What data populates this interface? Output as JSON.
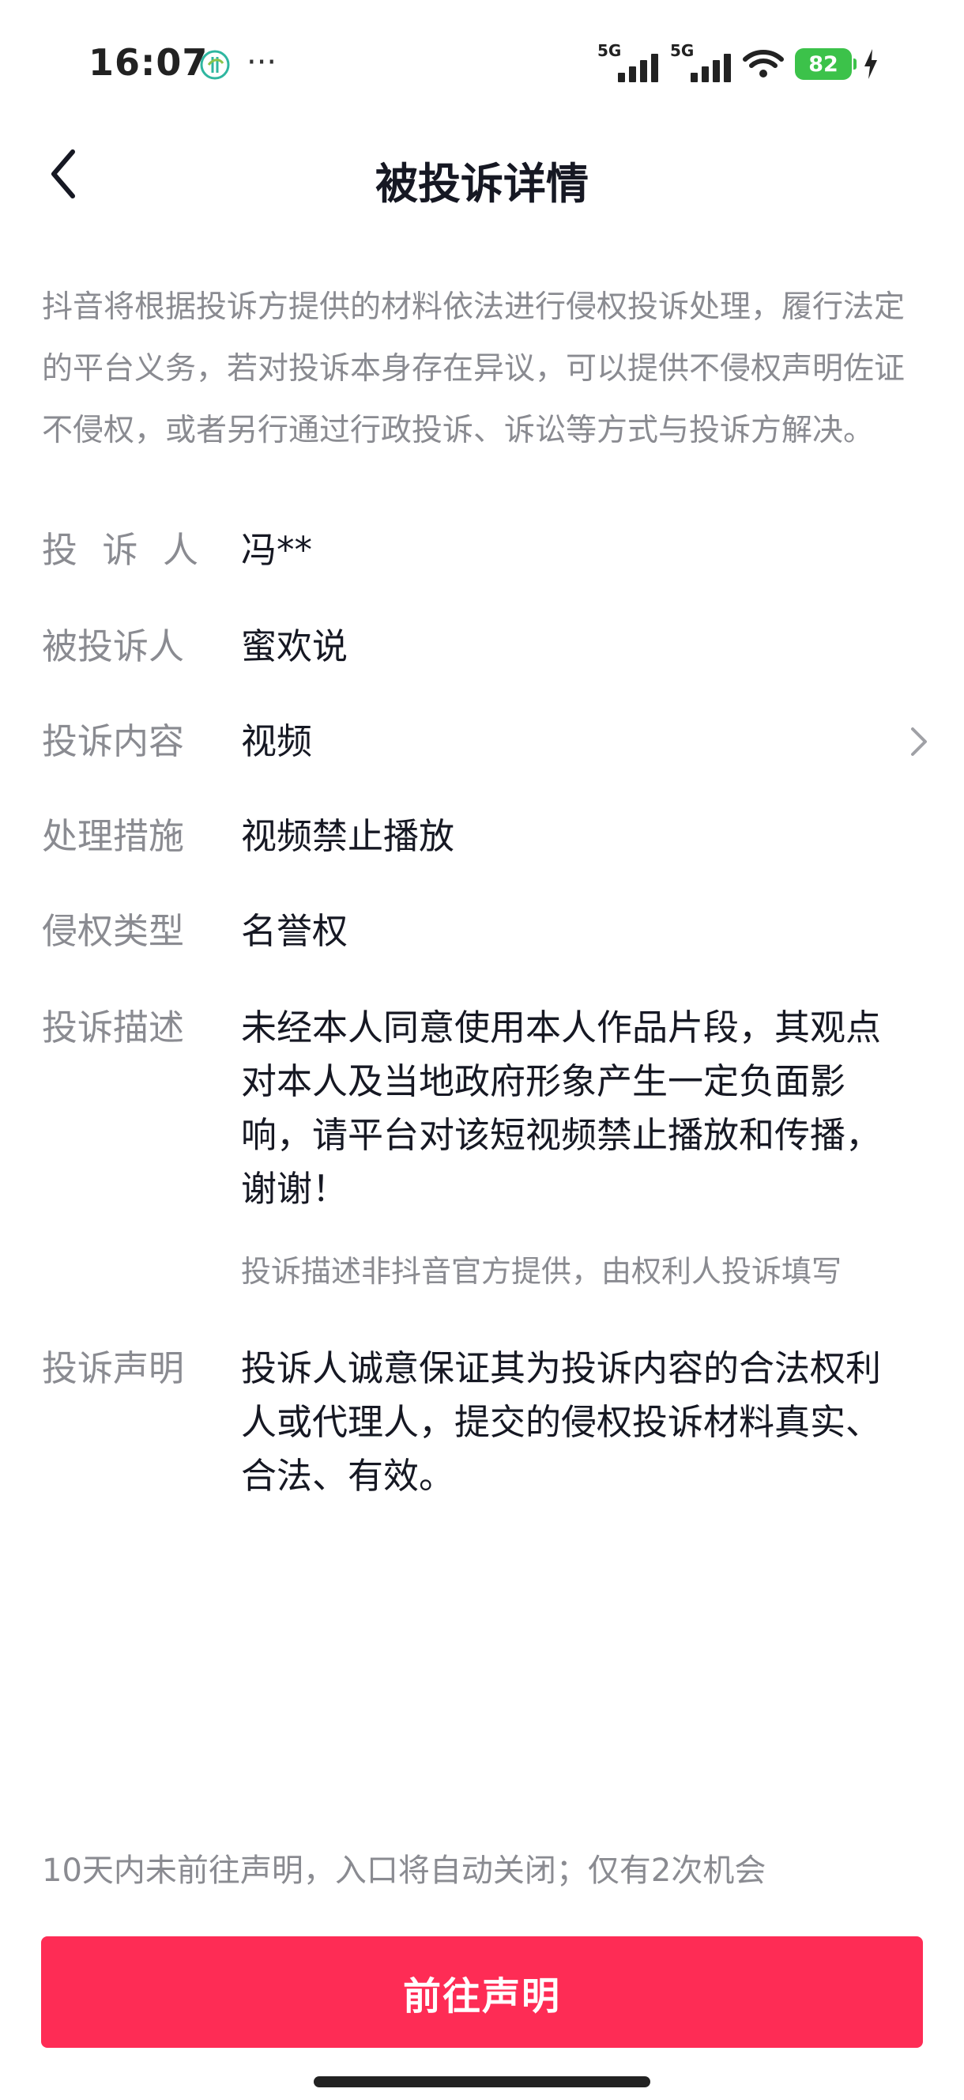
{
  "status_bar": {
    "time": "16:07",
    "more": "···",
    "network_1": "5G",
    "network_2": "5G",
    "battery": "82",
    "icons": [
      "app-notification-icon",
      "signal-icon",
      "wifi-icon",
      "battery-icon",
      "charging-icon"
    ]
  },
  "header": {
    "title": "被投诉详情",
    "back_icon": "chevron-left-icon"
  },
  "intro": "抖音将根据投诉方提供的材料依法进行侵权投诉处理，履行法定的平台义务，若对投诉本身存在异议，可以提供不侵权声明佐证不侵权，或者另行通过行政投诉、诉讼等方式与投诉方解决。",
  "details": {
    "complainant": {
      "label_chars": [
        "投",
        "诉",
        "人"
      ],
      "value": "冯**"
    },
    "respondent": {
      "label": "被投诉人",
      "value": "蜜欢说"
    },
    "content": {
      "label": "投诉内容",
      "value": "视频"
    },
    "measure": {
      "label": "处理措施",
      "value": "视频禁止播放"
    },
    "infringement_type": {
      "label": "侵权类型",
      "value": "名誉权"
    },
    "description": {
      "label": "投诉描述",
      "value": "未经本人同意使用本人作品片段，其观点对本人及当地政府形象产生一定负面影响，请平台对该短视频禁止播放和传播，谢谢！",
      "note": "投诉描述非抖音官方提供，由权利人投诉填写"
    },
    "statement": {
      "label": "投诉声明",
      "value": "投诉人诚意保证其为投诉内容的合法权利人或代理人，提交的侵权投诉材料真实、合法、有效。"
    }
  },
  "footer": {
    "note": "10天内未前往声明，入口将自动关闭；仅有2次机会",
    "button_label": "前往声明",
    "button_color": "#fe2c55"
  }
}
